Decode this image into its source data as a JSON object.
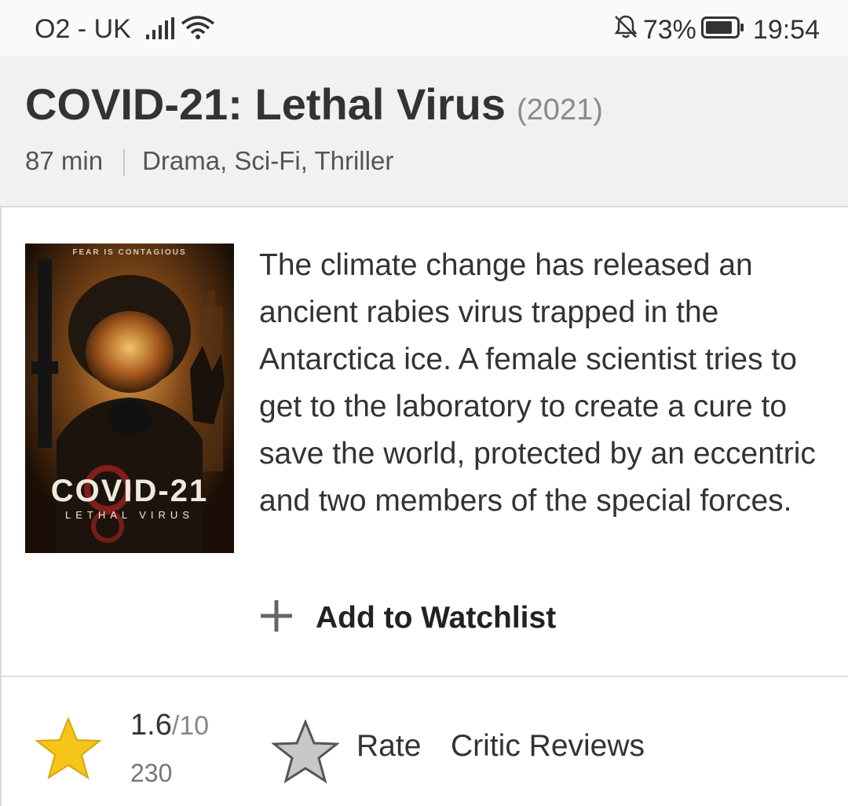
{
  "status_bar": {
    "carrier": "O2 - UK",
    "battery": "73%",
    "time": "19:54",
    "icons": [
      "signal-icon",
      "wifi-icon",
      "bell-off-icon",
      "battery-icon"
    ]
  },
  "movie": {
    "title": "COVID-21: Lethal Virus",
    "year": "(2021)",
    "runtime": "87 min",
    "genres": "Drama, Sci-Fi, Thriller",
    "plot": "The climate change has released an ancient rabies virus trapped in the Antarctica ice. A female scientist tries to get to the laboratory to create a cure to save the world, protected by an eccentric and two members of the special forces."
  },
  "poster": {
    "tagline": "FEAR IS CONTAGIOUS",
    "title_main": "COVID-21",
    "title_sub": "LETHAL VIRUS"
  },
  "actions": {
    "watchlist_label": "Add to Watchlist"
  },
  "ratings": {
    "score": "1.6",
    "max": "/10",
    "count": "230",
    "rate_label": "Rate",
    "critic_reviews_label": "Critic Reviews"
  },
  "colors": {
    "header_bg": "#f1f1f1",
    "star_gold": "#f5c518",
    "star_grey": "#c8c8c8"
  }
}
